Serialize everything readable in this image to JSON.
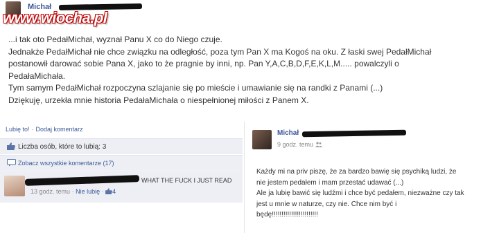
{
  "watermark": "www.wiocha.pl",
  "main_post": {
    "author": "Michał",
    "lines": [
      "...i tak oto PedałMichał, wyznał Panu X co do Niego czuje.",
      "Jednakże PedałMichał nie chce związku na odległość, poza tym Pan X ma Kogoś na oku. Z łaski swej PedałMichał",
      "postanowił darować sobie Pana X, jako to że pragnie by inni, np. Pan Y,A,C,B,D,F,E,K,L,M..... powalczyli o",
      "PedałaMichała.",
      "Tym samym PedałMichał rozpoczyna szlajanie się po mieście i umawianie się na randki z Panami (...)",
      "Dziękuję, urzekła mnie historia PedałaMichała o niespełnionej miłości z Panem X."
    ]
  },
  "actions": {
    "like": "Lubię to!",
    "comment": "Dodaj komentarz"
  },
  "likes": {
    "text": "Liczba osób, które to lubią: 3"
  },
  "view_all": {
    "text": "Zobacz wszystkie komentarze (17)"
  },
  "comment": {
    "text": "WHAT THE FUCK I JUST READ",
    "time": "13 godz. temu",
    "unlike": "Nie lubię",
    "like_count": "4"
  },
  "reply_post": {
    "author": "Michał",
    "time": "9 godz. temu",
    "lines": [
      "Każdy mi na priv piszę, że za bardzo bawię się psychiką ludzi, że",
      "nie jestem pedałem i mam przestać udawać (...)",
      "Ale ja lubię bawić się ludźmi i chce być pedałem, niezważne czy tak",
      "jest u mnie w naturze, czy nie. Chce nim być i",
      "będę!!!!!!!!!!!!!!!!!!!!!!!!"
    ]
  },
  "colors": {
    "link": "#3b5998",
    "panel": "#edeff4",
    "watermark_outline": "#c00000"
  }
}
